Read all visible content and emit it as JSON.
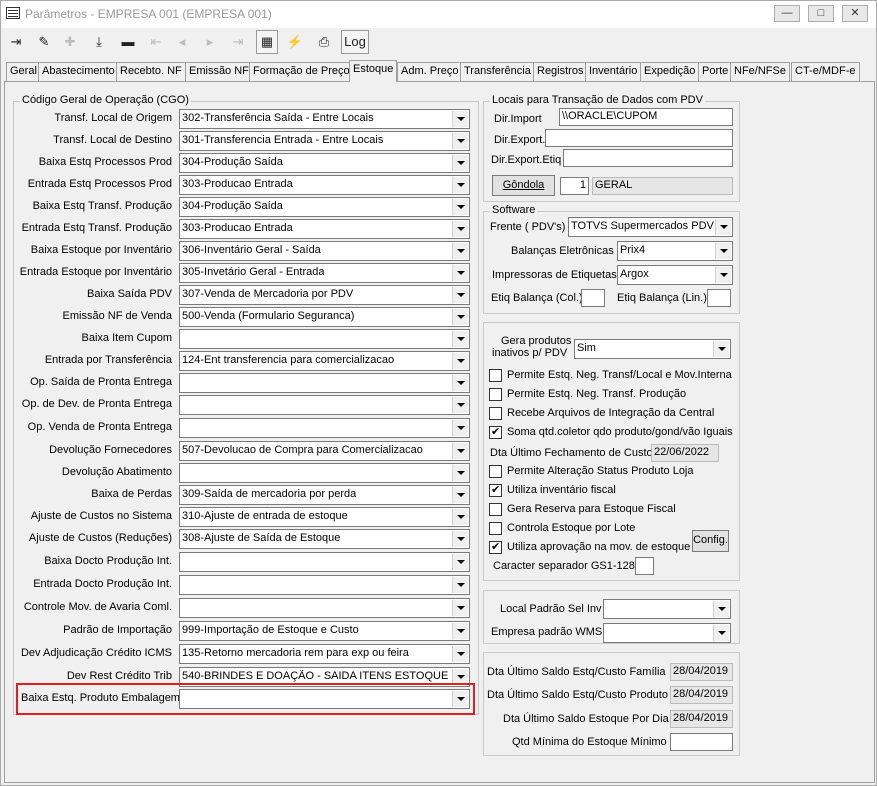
{
  "window": {
    "title": "Parâmetros - EMPRESA 001 (EMPRESA 001)",
    "minimize_label": "—",
    "maximize_label": "□",
    "close_label": "✕"
  },
  "toolbar": {
    "log_label": "Log"
  },
  "tabs": [
    {
      "label": "Geral"
    },
    {
      "label": "Abastecimento"
    },
    {
      "label": "Recebto. NF"
    },
    {
      "label": "Emissão NF"
    },
    {
      "label": "Formação de Preço"
    },
    {
      "label": "Estoque"
    },
    {
      "label": "Adm. Preço"
    },
    {
      "label": "Transferência"
    },
    {
      "label": "Registros"
    },
    {
      "label": "Inventário"
    },
    {
      "label": "Expedição"
    },
    {
      "label": "Porte"
    },
    {
      "label": "NFe/NFSe"
    },
    {
      "label": "CT-e/MDF-e"
    }
  ],
  "cgo": {
    "title": "Código Geral de Operação (CGO)",
    "rows": [
      {
        "label": "Transf. Local de Origem",
        "value": "302-Transferência Saída - Entre Locais"
      },
      {
        "label": "Transf. Local de Destino",
        "value": "301-Transferencia Entrada - Entre Locais"
      },
      {
        "label": "Baixa Estq Processos Prod",
        "value": "304-Produção Saída"
      },
      {
        "label": "Entrada Estq Processos Prod",
        "value": "303-Producao Entrada"
      },
      {
        "label": "Baixa Estq Transf. Produção",
        "value": "304-Produção Saída"
      },
      {
        "label": "Entrada Estq Transf. Produção",
        "value": "303-Producao Entrada"
      },
      {
        "label": "Baixa Estoque por Inventário",
        "value": "306-Inventário Geral - Saída"
      },
      {
        "label": "Entrada Estoque por Inventário",
        "value": "305-Invetário Geral - Entrada"
      },
      {
        "label": "Baixa Saída PDV",
        "value": "307-Venda de Mercadoria por PDV"
      },
      {
        "label": "Emissão NF de Venda",
        "value": "500-Venda (Formulario Seguranca)"
      },
      {
        "label": "Baixa Item Cupom",
        "value": ""
      },
      {
        "label": "Entrada por Transferência",
        "value": "124-Ent transferencia para comercializacao"
      },
      {
        "label": "Op. Saída de Pronta Entrega",
        "value": ""
      },
      {
        "label": "Op. de Dev. de Pronta Entrega",
        "value": ""
      },
      {
        "label": "Op. Venda de Pronta Entrega",
        "value": ""
      },
      {
        "label": "Devolução Fornecedores",
        "value": "507-Devolucao de Compra para Comercializacao"
      },
      {
        "label": "Devolução Abatimento",
        "value": ""
      },
      {
        "label": "Baixa de Perdas",
        "value": "309-Saída de mercadoria por perda"
      },
      {
        "label": "Ajuste de Custos no Sistema",
        "value": "310-Ajuste de entrada de estoque"
      },
      {
        "label": "Ajuste de Custos (Reduções)",
        "value": "308-Ajuste de Saída de Estoque"
      },
      {
        "label": "Baixa Docto Produção Int.",
        "value": ""
      },
      {
        "label": "Entrada Docto Produção Int.",
        "value": ""
      },
      {
        "label": "Controle Mov. de Avaria Coml.",
        "value": ""
      },
      {
        "label": "Padrão de Importação",
        "value": "999-Importação de Estoque e Custo"
      },
      {
        "label": "Dev Adjudicação Crédito ICMS",
        "value": "135-Retorno mercadoria rem para exp ou feira"
      },
      {
        "label": "Dev Rest Crédito Trib",
        "value": "540-BRINDES E DOAÇÃO - SAIDA ITENS ESTOQUE"
      },
      {
        "label": "Baixa Estq. Produto Embalagem",
        "value": ""
      }
    ]
  },
  "pdv_locais": {
    "title": "Locais para Transação de Dados com PDV",
    "dir_import_label": "Dir.Import",
    "dir_import_value": "\\\\ORACLE\\CUPOM",
    "dir_export_label": "Dir.Export.",
    "dir_export_value": "",
    "dir_export_etiq_label": "Dir.Export.Etiq",
    "dir_export_etiq_value": "",
    "gondola_label": "Gôndola",
    "gondola_num": "1",
    "gondola_name": "GERAL"
  },
  "software": {
    "title": "Software",
    "frente_label": "Frente  ( PDV's)",
    "frente_value": "TOTVS Supermercados PDV",
    "balancas_label": "Balanças Eletrônicas",
    "balancas_value": "Prix4",
    "impressoras_label": "Impressoras de Etiquetas",
    "impressoras_value": "Argox",
    "etiq_col_label": "Etiq Balança (Col.)",
    "etiq_col_value": "",
    "etiq_lin_label": "Etiq Balança (Lin.)",
    "etiq_lin_value": ""
  },
  "options": {
    "gera_label_1": "Gera produtos",
    "gera_label_2": "inativos p/ PDV",
    "gera_value": "Sim",
    "checks": [
      {
        "label": "Permite Estq. Neg. Transf/Local e Mov.Interna",
        "checked": false
      },
      {
        "label": "Permite Estq. Neg. Transf. Produção",
        "checked": false
      },
      {
        "label": "Recebe Arquivos de Integração da Central",
        "checked": false
      },
      {
        "label": "Soma qtd.coletor qdo produto/gond/vão  Iguais",
        "checked": true
      }
    ],
    "dta_fech_label": "Dta Último Fechamento de Custo",
    "dta_fech_value": "22/06/2022",
    "checks2": [
      {
        "label": "Permite Alteração Status Produto Loja",
        "checked": false
      },
      {
        "label": "Utiliza inventário fiscal",
        "checked": true
      },
      {
        "label": "Gera Reserva para Estoque Fiscal",
        "checked": false
      },
      {
        "label": "Controla Estoque por Lote",
        "checked": false
      },
      {
        "label": "Utiliza aprovação na mov. de estoque",
        "checked": true
      }
    ],
    "config_label": "Config.",
    "caracter_label": "Caracter separador GS1-128",
    "caracter_value": ""
  },
  "inventario": {
    "local_label": "Local Padrão Sel Inv",
    "local_value": "",
    "empresa_label": "Empresa padrão WMS",
    "empresa_value": ""
  },
  "saldos": [
    {
      "label": "Dta Último Saldo Estq/Custo Família",
      "value": "28/04/2019"
    },
    {
      "label": "Dta Último Saldo Estq/Custo Produto",
      "value": "28/04/2019"
    },
    {
      "label": "Dta Último Saldo Estoque Por Dia",
      "value": "28/04/2019"
    },
    {
      "label": "Qtd Mínima do Estoque Mínimo",
      "value": ""
    }
  ]
}
